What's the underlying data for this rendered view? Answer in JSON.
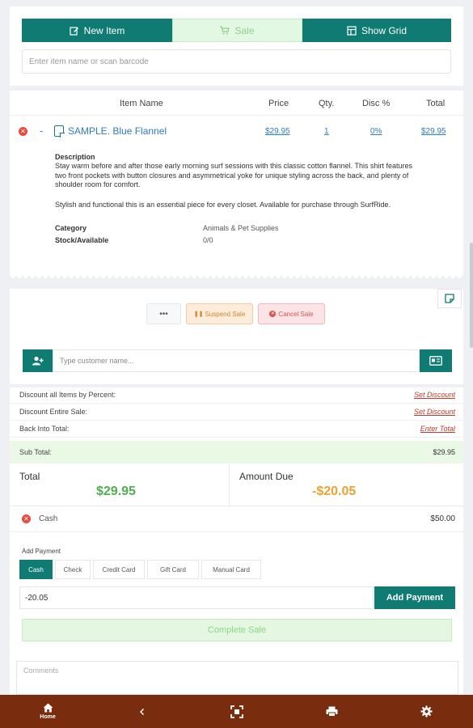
{
  "toolbar": {
    "tabs": [
      {
        "label": "New Item",
        "icon": "edit-icon"
      },
      {
        "label": "Sale",
        "icon": "cart-icon"
      },
      {
        "label": "Show Grid",
        "icon": "grid-icon"
      }
    ],
    "search_placeholder": "Enter item name or scan barcode"
  },
  "items_table": {
    "headers": [
      "Item Name",
      "Price",
      "Qty.",
      "Disc %",
      "Total"
    ],
    "rows": [
      {
        "name": "SAMPLE. Blue Flannel",
        "price": "$29.95",
        "qty": "1",
        "disc": "0%",
        "total": "$29.95",
        "description_label": "Description",
        "description_lines": [
          "Stay warm before and after those early morning surf sessions with this classic cotton flannel. This shirt features",
          "two front pockets with button closures and asymmetrical yoke for unique styling across the back, and plenty of",
          "shoulder room for comfort."
        ],
        "description_para2": "Stylish and functional this is an essential piece for every closet. Available for purchase through SurfRide.",
        "category_label": "Category",
        "category_value": "Animals & Pet Supplies",
        "stock_label": "Stock/Available",
        "stock_value": "0/0"
      }
    ]
  },
  "actions": {
    "more_label": "•••",
    "suspend_label": "Suspend Sale",
    "cancel_label": "Cancel Sale",
    "customer_placeholder": "Type customer name..."
  },
  "payment": {
    "discount_rows": [
      {
        "label": "Discount all Items by Percent:",
        "action": "Set Discount"
      },
      {
        "label": "Discount Entire Sale:",
        "action": "Set Discount"
      },
      {
        "label": "Back Into Total:",
        "action": "Enter Total"
      }
    ],
    "subtotal_label": "Sub Total:",
    "subtotal_value": "$29.95",
    "total_label": "Total",
    "total_value": "$29.95",
    "amount_due_label": "Amount Due",
    "amount_due_value": "-$20.05",
    "applied_payment": {
      "method": "Cash",
      "amount": "$50.00"
    },
    "add_payment_label": "Add Payment",
    "methods": [
      "Cash",
      "Check",
      "Credit Card",
      "Gift Card",
      "Manual Card"
    ],
    "selected_method": "Cash",
    "amount_input_value": "-20.05",
    "add_payment_button": "Add Payment",
    "complete_sale_button": "Complete Sale",
    "comments_placeholder": "Comments"
  },
  "nav": {
    "home_label": "Home"
  },
  "colors": {
    "accent": "#0f7b73",
    "success": "#4caf50",
    "warning": "#f0a030",
    "danger": "#e74c3c",
    "nav_bg": "#7a2c0f"
  }
}
